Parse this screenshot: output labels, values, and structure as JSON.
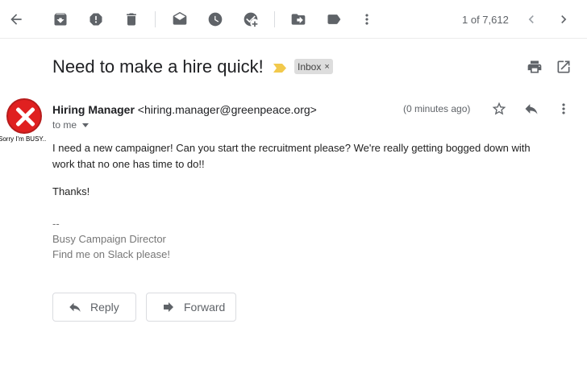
{
  "toolbar": {
    "icons": [
      "back-icon",
      "archive-icon",
      "report-spam-icon",
      "delete-icon",
      "mark-unread-icon",
      "snooze-icon",
      "add-to-tasks-icon",
      "move-to-icon",
      "labels-icon",
      "more-vert-icon",
      "prev-icon",
      "next-icon"
    ],
    "pager": "1 of 7,612"
  },
  "message": {
    "subject": "Need to make a hire quick!",
    "label": "Inbox",
    "label_remove": "×",
    "sender_name": "Hiring Manager",
    "sender_email": "<hiring.manager@greenpeace.org>",
    "recipient": "to me",
    "time": "(0 minutes ago)",
    "avatar_caption": "Sorry I'm BUSY..",
    "body": "I need a new campaigner!  Can you start the recruitment please?  We're really getting bogged down with work that no one has time to do!!",
    "closing": "Thanks!",
    "signature": [
      "--",
      "Busy Campaign Director",
      "Find me on Slack please!"
    ]
  },
  "actions": {
    "reply": "Reply",
    "forward": "Forward"
  },
  "colors": {
    "importance": "#f2c94c",
    "avatar": "#e02020",
    "label_bg": "#dddddd"
  }
}
